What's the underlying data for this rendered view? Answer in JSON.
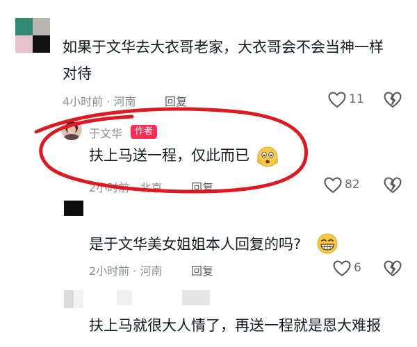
{
  "colors": {
    "accent": "#fe2c55",
    "annotation": "#e0181f",
    "text": "#161823",
    "meta": "#8a8b91"
  },
  "comments": [
    {
      "text_line1": "如果于文华去大衣哥老家，大衣哥会不会当神一样",
      "text_line2": "对待",
      "time_location": "4小时前 · 河南",
      "reply_label": "回复",
      "likes": "11",
      "avatar": "mosaic-avatar"
    },
    {
      "username": "于文华",
      "badge": "作者",
      "text": "扶上马送一程，仅此而已",
      "emoji": "surprised-face-emoji",
      "time_location": "2小时前 · 北京",
      "reply_label": "回复",
      "likes": "82",
      "avatar": "photo-avatar"
    },
    {
      "text": "是于文华美女姐姐本人回复的吗?",
      "emoji": "grinning-face-emoji",
      "time_location": "2小时前 · 河南",
      "reply_label": "回复",
      "likes": "6",
      "avatar": "black-square-avatar"
    },
    {
      "text": "扶上马就很大人情了，再送一程就是恩大难报",
      "avatar": "mosaic-avatar"
    }
  ]
}
